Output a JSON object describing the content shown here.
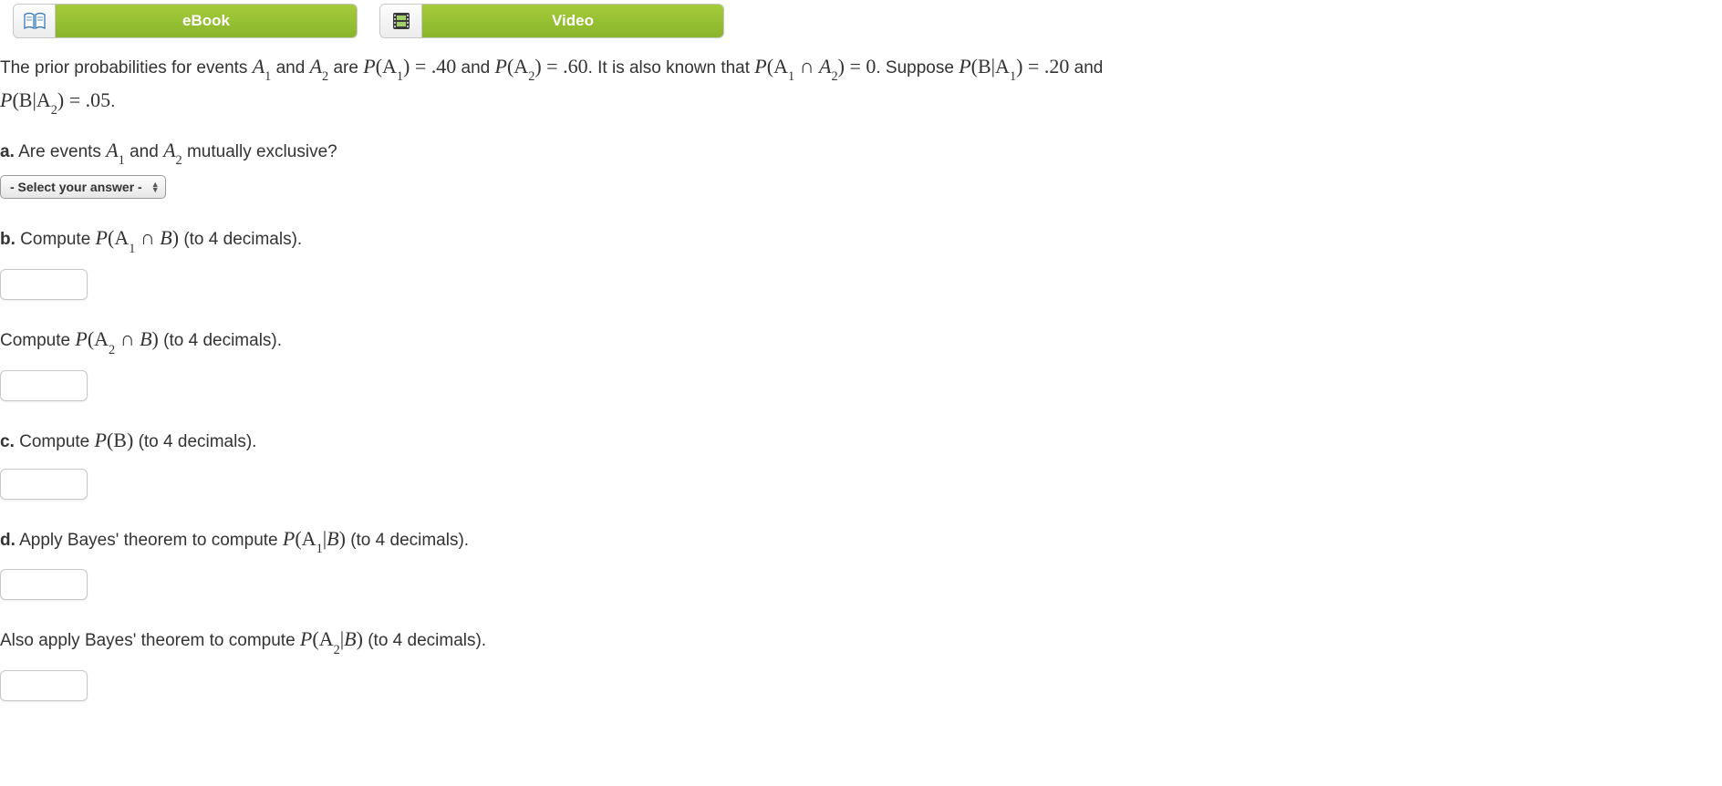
{
  "buttons": {
    "ebook": {
      "label": "eBook",
      "icon": "book-icon"
    },
    "video": {
      "label": "Video",
      "icon": "film-icon"
    }
  },
  "intro": {
    "t1": "The prior probabilities for events ",
    "a1": "A",
    "sub1": "1",
    "t2": " and ",
    "a2": "A",
    "sub2": "2",
    "t3": " are ",
    "pa1": "P",
    "pa1_arg": "(A",
    "pa1_sub": "1",
    "pa1_close": ") = .40",
    "t4": " and ",
    "pa2": "P",
    "pa2_arg": "(A",
    "pa2_sub": "2",
    "pa2_close": ") = .60",
    "t5": ". It is also known that ",
    "pint": "P",
    "pint_arg": "(A",
    "pint_sub1": "1",
    "pint_cap": " ∩ ",
    "pint_a2": "A",
    "pint_sub2": "2",
    "pint_close": ") = 0",
    "t6": ". Suppose ",
    "pba1": "P",
    "pba1_arg": "(B|A",
    "pba1_sub": "1",
    "pba1_close": ") = .20",
    "t7": " and",
    "line2_p": "P",
    "line2_arg": "(B|A",
    "line2_sub": "2",
    "line2_close": ") = .05",
    "line2_end": "."
  },
  "qa": {
    "letter": "a.",
    "t1": " Are events ",
    "a1": "A",
    "s1": "1",
    "t2": " and ",
    "a2": "A",
    "s2": "2",
    "t3": " mutually exclusive?"
  },
  "select_placeholder": "- Select your answer -",
  "qb": {
    "letter": "b.",
    "t1": " Compute ",
    "p": "P",
    "arg": "(A",
    "sub": "1",
    "cap": " ∩ ",
    "b": "B",
    "close": ")",
    "t2": " (to 4 decimals)."
  },
  "qb2": {
    "t1": "Compute ",
    "p": "P",
    "arg": "(A",
    "sub": "2",
    "cap": " ∩ ",
    "b": "B",
    "close": ")",
    "t2": " (to 4 decimals)."
  },
  "qc": {
    "letter": "c.",
    "t1": " Compute ",
    "p": "P",
    "arg": "(B",
    "close": ")",
    "t2": " (to 4 decimals)."
  },
  "qd": {
    "letter": "d.",
    "t1": " Apply Bayes' theorem to compute ",
    "p": "P",
    "arg": "(A",
    "sub": "1",
    "bar": "|",
    "b": "B",
    "close": ")",
    "t2": " (to 4 decimals)."
  },
  "qd2": {
    "t1": "Also apply Bayes' theorem to compute ",
    "p": "P",
    "arg": "(A",
    "sub": "2",
    "bar": "|",
    "b": "B",
    "close": ")",
    "t2": " (to 4 decimals)."
  }
}
